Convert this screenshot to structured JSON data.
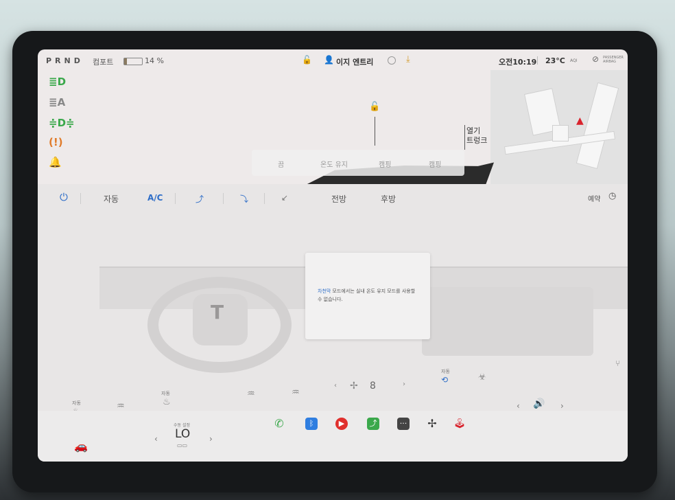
{
  "status": {
    "gear": "PRND",
    "drive_mode": "컴포트",
    "battery_percent": "14 %",
    "battery_level": 0.14,
    "profile": "이지 엔트리",
    "time": "오전10:19",
    "temperature": "23°C",
    "aqi": "AQI",
    "airbag": "PASSENGER AIRBAG"
  },
  "car_view": {
    "trunk_line1": "열기",
    "trunk_line2": "트렁크",
    "quick_actions": [
      "끔",
      "온도 유지",
      "캠핑",
      "캠핑"
    ]
  },
  "climate": {
    "auto": "자동",
    "ac": "A/C",
    "front": "전방",
    "rear": "후방",
    "schedule": "예약",
    "popup_highlight": "차천막",
    "popup_text": " 모드에서는 실내 온도 유지 모드를 사용할 수 없습니다.",
    "fan_speed": "8",
    "seat_auto_left": "자동",
    "seat_auto_right": "자동",
    "recirc_auto": "자동"
  },
  "dock": {
    "temp_label": "수동 설정",
    "temp_value": "LO"
  },
  "colors": {
    "accent_blue": "#2f6ec8",
    "green_indicator": "#3aa84b",
    "warning_orange": "#e07b2a",
    "red_indicator": "#d9232d"
  }
}
